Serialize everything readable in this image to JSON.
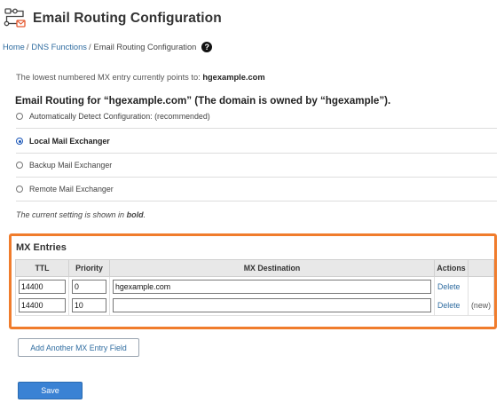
{
  "header": {
    "icon": "email-routing-icon",
    "title": "Email Routing Configuration"
  },
  "breadcrumb": {
    "items": [
      "Home",
      "DNS Functions"
    ],
    "separator": "/",
    "current": "Email Routing Configuration",
    "help_icon": "question-circle-icon",
    "help_glyph": "?"
  },
  "mx_note": {
    "text": "The lowest numbered MX entry currently points to:",
    "host": "hgexample.com"
  },
  "routing": {
    "heading": "Email Routing for “hgexample.com” (The domain is owned by “hgexample”).",
    "options": [
      {
        "label": "Automatically Detect Configuration: (recommended)",
        "checked": false,
        "bold": false
      },
      {
        "label": "Local Mail Exchanger",
        "checked": true,
        "bold": true
      },
      {
        "label": "Backup Mail Exchanger",
        "checked": false,
        "bold": false
      },
      {
        "label": "Remote Mail Exchanger",
        "checked": false,
        "bold": false
      }
    ]
  },
  "current_note": {
    "prefix": "The current setting is shown in",
    "emphasis": "bold",
    "suffix": "."
  },
  "mx_entries": {
    "title": "MX Entries",
    "columns": [
      "TTL",
      "Priority",
      "MX Destination",
      "Actions",
      ""
    ],
    "rows": [
      {
        "ttl": "14400",
        "priority": "0",
        "destination": "hgexample.com",
        "action": "Delete",
        "tag": ""
      },
      {
        "ttl": "14400",
        "priority": "10",
        "destination": "",
        "action": "Delete",
        "tag": "(new)"
      }
    ]
  },
  "buttons": {
    "add_label": "Add Another MX Entry Field",
    "save_label": "Save"
  },
  "colors": {
    "accent": "#f07c2c",
    "link": "#2f6ca0",
    "primary_button": "#3a82d4",
    "table_header": "#e8e8e8"
  }
}
